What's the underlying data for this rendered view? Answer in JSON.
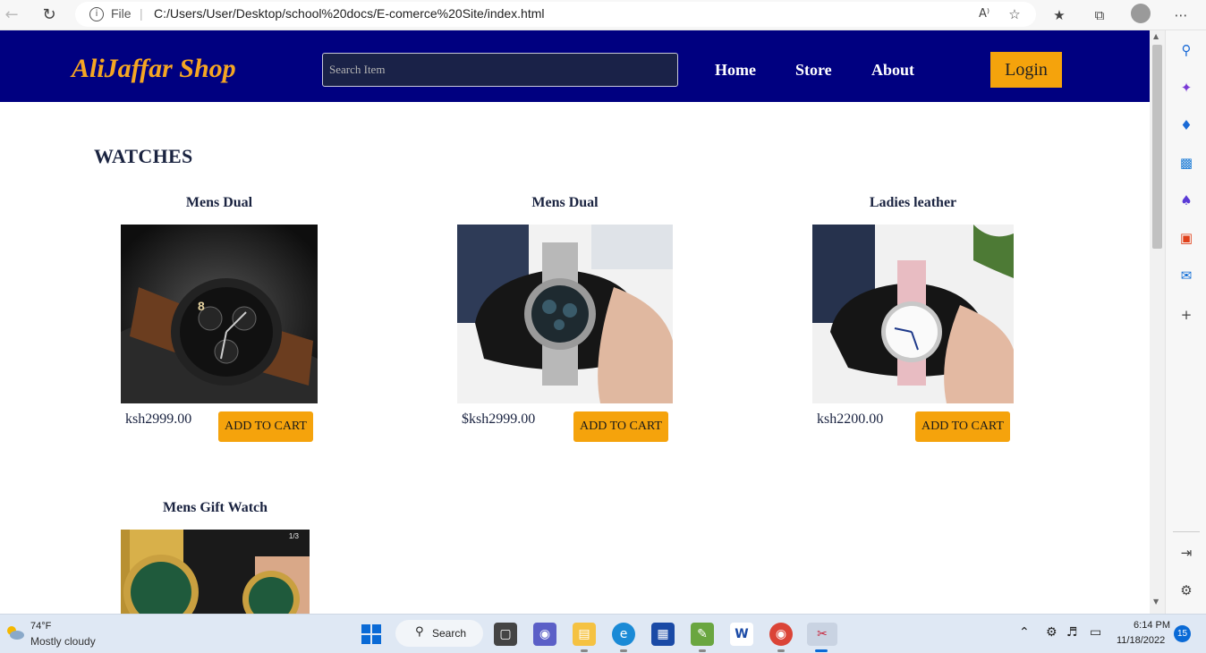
{
  "browser": {
    "file_label": "File",
    "url": "C:/Users/User/Desktop/school%20docs/E-comerce%20Site/index.html",
    "read_aloud_label": "A⁾"
  },
  "site": {
    "logo": "AliJaffar Shop",
    "search_placeholder": "Search Item",
    "nav": [
      "Home",
      "Store",
      "About"
    ],
    "login_label": "Login",
    "section_title": "WATCHES"
  },
  "products": [
    {
      "name": "Mens Dual",
      "price": "ksh2999.00",
      "button": "ADD TO CART"
    },
    {
      "name": "Mens Dual",
      "price": "$ksh2999.00",
      "button": "ADD TO CART"
    },
    {
      "name": "Ladies leather",
      "price": "ksh2200.00",
      "button": "ADD TO CART"
    },
    {
      "name": "Mens Gift Watch",
      "image_counter": "1/3"
    }
  ],
  "taskbar": {
    "temperature": "74°F",
    "weather": "Mostly cloudy",
    "search_label": "Search",
    "time": "6:14 PM",
    "date": "11/18/2022",
    "notifications": "15"
  },
  "colors": {
    "header_bg": "#000080",
    "accent": "#f5a30c",
    "logo": "#f5a623",
    "text_dark": "#1a2340"
  }
}
